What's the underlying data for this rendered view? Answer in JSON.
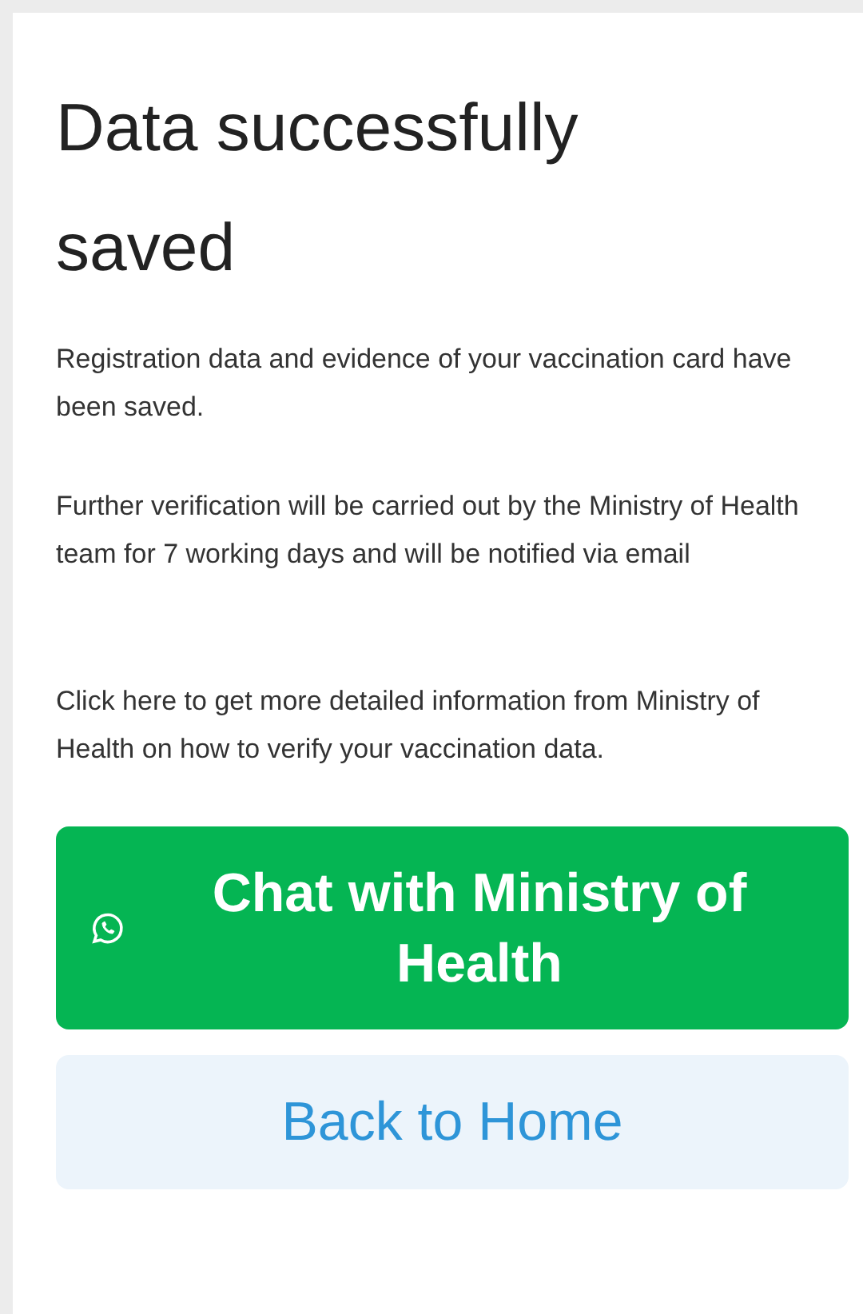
{
  "title": "Data successfully saved",
  "paragraphs": [
    "Registration data and evidence of your vaccination card have been saved.",
    "Further verification will be carried out by the Ministry of Health team for 7 working days and will be notified via email",
    "Click here to get more detailed information from Ministry of Health on how to verify your vaccination data."
  ],
  "buttons": [
    {
      "kind": "chat",
      "label": "Chat with Ministry of Health"
    },
    {
      "kind": "home",
      "label": "Back to Home"
    }
  ]
}
